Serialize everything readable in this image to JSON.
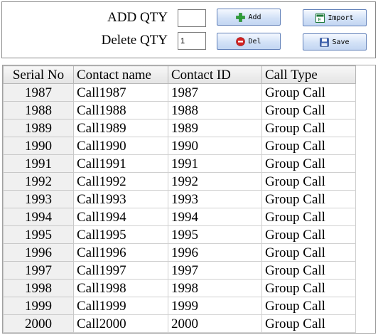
{
  "controls": {
    "add_qty_label": "ADD QTY",
    "add_qty_value": "",
    "delete_qty_label": "Delete QTY",
    "delete_qty_value": "1",
    "add_button_label": "Add",
    "del_button_label": "Del",
    "import_button_label": "Import",
    "save_button_label": "Save"
  },
  "icons": {
    "add": "plus-icon",
    "del": "delete-icon",
    "import": "excel-import-icon",
    "save": "floppy-disk-icon"
  },
  "colors": {
    "add_icon": "#2fa13a",
    "del_icon": "#d32222",
    "import_icon": "#1f7a3a",
    "save_icon": "#3a5fae",
    "button_border": "#5f7fb8"
  },
  "table": {
    "columns": [
      "Serial No",
      "Contact name",
      "Contact ID",
      "Call Type"
    ],
    "rows": [
      [
        "1987",
        "Call1987",
        "1987",
        "Group Call"
      ],
      [
        "1988",
        "Call1988",
        "1988",
        "Group Call"
      ],
      [
        "1989",
        "Call1989",
        "1989",
        "Group Call"
      ],
      [
        "1990",
        "Call1990",
        "1990",
        "Group Call"
      ],
      [
        "1991",
        "Call1991",
        "1991",
        "Group Call"
      ],
      [
        "1992",
        "Call1992",
        "1992",
        "Group Call"
      ],
      [
        "1993",
        "Call1993",
        "1993",
        "Group Call"
      ],
      [
        "1994",
        "Call1994",
        "1994",
        "Group Call"
      ],
      [
        "1995",
        "Call1995",
        "1995",
        "Group Call"
      ],
      [
        "1996",
        "Call1996",
        "1996",
        "Group Call"
      ],
      [
        "1997",
        "Call1997",
        "1997",
        "Group Call"
      ],
      [
        "1998",
        "Call1998",
        "1998",
        "Group Call"
      ],
      [
        "1999",
        "Call1999",
        "1999",
        "Group Call"
      ],
      [
        "2000",
        "Call2000",
        "2000",
        "Group Call"
      ]
    ]
  }
}
